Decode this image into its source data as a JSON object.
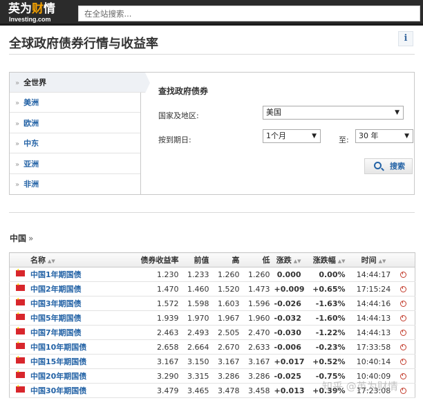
{
  "header": {
    "logo_main": "英为财情",
    "logo_highlight_char": "财",
    "logo_sub": "Investing.com",
    "search_placeholder": "在全站搜索..."
  },
  "page": {
    "title": "全球政府债券行情与收益率",
    "info_icon_glyph": "i"
  },
  "regions": [
    {
      "label": "全世界",
      "active": true
    },
    {
      "label": "美洲",
      "active": false
    },
    {
      "label": "欧洲",
      "active": false
    },
    {
      "label": "中东",
      "active": false
    },
    {
      "label": "亚洲",
      "active": false
    },
    {
      "label": "非洲",
      "active": false
    }
  ],
  "finder": {
    "title": "查找政府债券",
    "country_label": "国家及地区:",
    "country_value": "美国",
    "maturity_label": "按到期日:",
    "maturity_from": "1个月",
    "to_label": "至:",
    "maturity_to": "30 年",
    "search_button": "搜索"
  },
  "country_section": {
    "heading": "中国",
    "raquo": "»"
  },
  "table": {
    "headers": {
      "name": "名称",
      "yield": "债券收益率",
      "prev": "前值",
      "high": "高",
      "low": "低",
      "change": "涨跌",
      "change_pct": "涨跌幅",
      "time": "时间"
    },
    "rows": [
      {
        "name": "中国1年期国债",
        "yield": "1.230",
        "prev": "1.233",
        "high": "1.260",
        "low": "1.260",
        "change": "0.000",
        "change_pct": "0.00%",
        "time": "14:44:17",
        "dir": "zero"
      },
      {
        "name": "中国2年期国债",
        "yield": "1.470",
        "prev": "1.460",
        "high": "1.520",
        "low": "1.473",
        "change": "+0.009",
        "change_pct": "+0.65%",
        "time": "17:15:24",
        "dir": "pos"
      },
      {
        "name": "中国3年期国债",
        "yield": "1.572",
        "prev": "1.598",
        "high": "1.603",
        "low": "1.596",
        "change": "-0.026",
        "change_pct": "-1.63%",
        "time": "14:44:16",
        "dir": "neg"
      },
      {
        "name": "中国5年期国债",
        "yield": "1.939",
        "prev": "1.970",
        "high": "1.967",
        "low": "1.960",
        "change": "-0.032",
        "change_pct": "-1.60%",
        "time": "14:44:13",
        "dir": "neg"
      },
      {
        "name": "中国7年期国债",
        "yield": "2.463",
        "prev": "2.493",
        "high": "2.505",
        "low": "2.470",
        "change": "-0.030",
        "change_pct": "-1.22%",
        "time": "14:44:13",
        "dir": "neg"
      },
      {
        "name": "中国10年期国债",
        "yield": "2.658",
        "prev": "2.664",
        "high": "2.670",
        "low": "2.633",
        "change": "-0.006",
        "change_pct": "-0.23%",
        "time": "17:33:58",
        "dir": "neg"
      },
      {
        "name": "中国15年期国债",
        "yield": "3.167",
        "prev": "3.150",
        "high": "3.167",
        "low": "3.167",
        "change": "+0.017",
        "change_pct": "+0.52%",
        "time": "10:40:14",
        "dir": "pos"
      },
      {
        "name": "中国20年期国债",
        "yield": "3.290",
        "prev": "3.315",
        "high": "3.286",
        "low": "3.286",
        "change": "-0.025",
        "change_pct": "-0.75%",
        "time": "10:40:09",
        "dir": "neg"
      },
      {
        "name": "中国30年期国债",
        "yield": "3.479",
        "prev": "3.465",
        "high": "3.478",
        "low": "3.458",
        "change": "+0.013",
        "change_pct": "+0.39%",
        "time": "17:23:08",
        "dir": "pos"
      }
    ]
  },
  "watermark": "知乎 @英为财情",
  "colors": {
    "topbar": "#2b2b2b",
    "link_blue": "#2463a6",
    "positive_red": "#c41a1a",
    "negative_green": "#0a9a2a",
    "flag_red": "#d8262c"
  }
}
